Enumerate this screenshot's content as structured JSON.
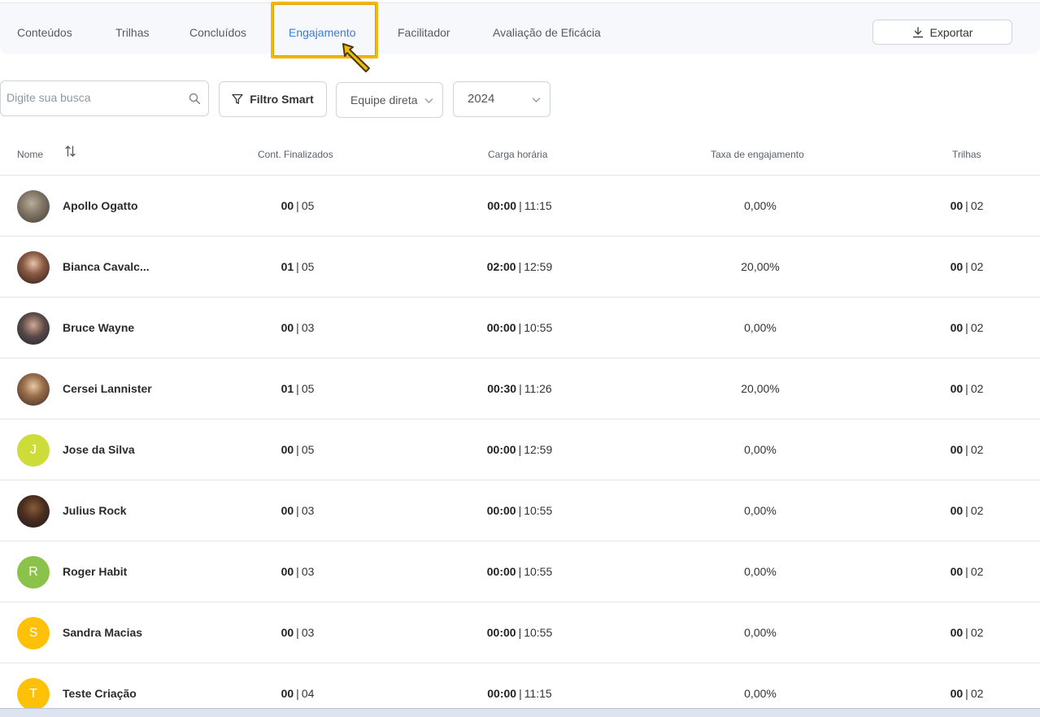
{
  "tabs": [
    {
      "label": "Conteúdos",
      "active": false
    },
    {
      "label": "Trilhas",
      "active": false
    },
    {
      "label": "Concluídos",
      "active": false
    },
    {
      "label": "Engajamento",
      "active": true
    },
    {
      "label": "Facilitador",
      "active": false
    },
    {
      "label": "Avaliação de Eficácia",
      "active": false
    }
  ],
  "toolbar": {
    "export_label": "Exportar",
    "search_placeholder": "Digite sua busca",
    "filter_label": "Filtro Smart",
    "team_select": "Equipe direta",
    "year_select": "2024"
  },
  "table": {
    "headers": {
      "name": "Nome",
      "finished": "Cont. Finalizados",
      "workload": "Carga horária",
      "engagement": "Taxa de engajamento",
      "tracks": "Trilhas"
    },
    "rows": [
      {
        "name": "Apollo Ogatto",
        "avatar": "photo",
        "finished_a": "00",
        "finished_b": "05",
        "hours_a": "00:00",
        "hours_b": "11:15",
        "rate": "0,00%",
        "tracks_a": "00",
        "tracks_b": "02"
      },
      {
        "name": "Bianca Cavalc...",
        "avatar": "photo",
        "finished_a": "01",
        "finished_b": "05",
        "hours_a": "02:00",
        "hours_b": "12:59",
        "rate": "20,00%",
        "tracks_a": "00",
        "tracks_b": "02"
      },
      {
        "name": "Bruce Wayne",
        "avatar": "photo",
        "finished_a": "00",
        "finished_b": "03",
        "hours_a": "00:00",
        "hours_b": "10:55",
        "rate": "0,00%",
        "tracks_a": "00",
        "tracks_b": "02"
      },
      {
        "name": "Cersei Lannister",
        "avatar": "photo",
        "finished_a": "01",
        "finished_b": "05",
        "hours_a": "00:30",
        "hours_b": "11:26",
        "rate": "20,00%",
        "tracks_a": "00",
        "tracks_b": "02"
      },
      {
        "name": "Jose da Silva",
        "avatar": "J",
        "avatar_color": "#cddc39",
        "finished_a": "00",
        "finished_b": "05",
        "hours_a": "00:00",
        "hours_b": "12:59",
        "rate": "0,00%",
        "tracks_a": "00",
        "tracks_b": "02"
      },
      {
        "name": "Julius Rock",
        "avatar": "photo",
        "finished_a": "00",
        "finished_b": "03",
        "hours_a": "00:00",
        "hours_b": "10:55",
        "rate": "0,00%",
        "tracks_a": "00",
        "tracks_b": "02"
      },
      {
        "name": "Roger Habit",
        "avatar": "R",
        "avatar_color": "#8bc34a",
        "finished_a": "00",
        "finished_b": "03",
        "hours_a": "00:00",
        "hours_b": "10:55",
        "rate": "0,00%",
        "tracks_a": "00",
        "tracks_b": "02"
      },
      {
        "name": "Sandra Macias",
        "avatar": "S",
        "avatar_color": "#ffc107",
        "finished_a": "00",
        "finished_b": "03",
        "hours_a": "00:00",
        "hours_b": "10:55",
        "rate": "0,00%",
        "tracks_a": "00",
        "tracks_b": "02"
      },
      {
        "name": "Teste Criação",
        "avatar": "T",
        "avatar_color": "#ffc107",
        "finished_a": "00",
        "finished_b": "04",
        "hours_a": "00:00",
        "hours_b": "11:15",
        "rate": "0,00%",
        "tracks_a": "00",
        "tracks_b": "02"
      }
    ]
  },
  "colors": {
    "accent": "#3d7be0",
    "highlight": "#f1b90f"
  }
}
